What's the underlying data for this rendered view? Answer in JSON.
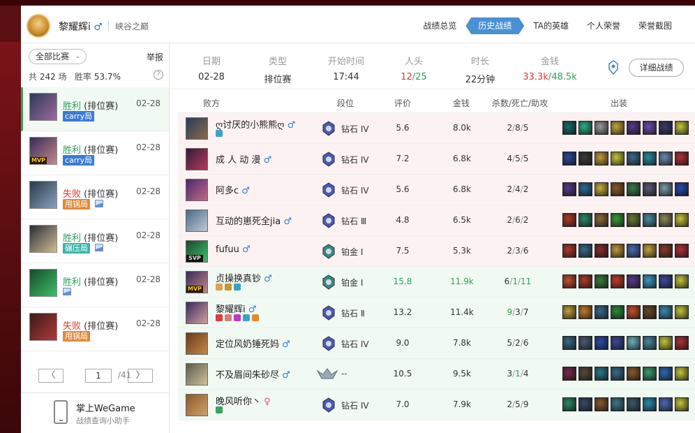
{
  "header": {
    "player_name": "黎耀辉i",
    "gender_symbol": "♂",
    "server": "峡谷之巅",
    "tabs": [
      {
        "label": "战绩总览",
        "active": false
      },
      {
        "label": "历史战绩",
        "active": true
      },
      {
        "label": "TA的英雄",
        "active": false
      },
      {
        "label": "个人荣誉",
        "active": false
      },
      {
        "label": "荣誉截图",
        "active": false
      }
    ]
  },
  "sidebar": {
    "filter_label": "全部比赛",
    "report_label": "举报",
    "stats_total_prefix": "共",
    "stats_total": "242",
    "stats_total_suffix": "场",
    "stats_winrate_label": "胜率",
    "stats_winrate": "53.7%",
    "help_symbol": "?",
    "matches": [
      {
        "result": "胜利",
        "type": "(排位赛)",
        "date": "02-28",
        "tag": "carry局",
        "mvp": "",
        "has_image": false,
        "win": true
      },
      {
        "result": "胜利",
        "type": "(排位赛)",
        "date": "02-28",
        "tag": "carry局",
        "mvp": "MVP",
        "has_image": false,
        "win": true
      },
      {
        "result": "失败",
        "type": "(排位赛)",
        "date": "02-28",
        "tag": "甩锅局",
        "mvp": "",
        "has_image": true,
        "win": false
      },
      {
        "result": "胜利",
        "type": "(排位赛)",
        "date": "02-28",
        "tag": "碾压局",
        "mvp": "",
        "has_image": true,
        "win": true
      },
      {
        "result": "胜利",
        "type": "(排位赛)",
        "date": "02-28",
        "tag": "",
        "mvp": "",
        "has_image": true,
        "win": true
      },
      {
        "result": "失败",
        "type": "(排位赛)",
        "date": "02-28",
        "tag": "甩锅局",
        "mvp": "",
        "has_image": false,
        "win": false
      }
    ],
    "pager": {
      "prev": "〈",
      "next": "〉",
      "current": "1",
      "total": "/41"
    },
    "wegame": {
      "title": "掌上WeGame",
      "subtitle": "战绩查询小助手"
    }
  },
  "summary": {
    "date_label": "日期",
    "date": "02-28",
    "type_label": "类型",
    "type": "排位赛",
    "start_label": "开始时间",
    "start": "17:44",
    "kills_label": "人头",
    "kills_red": "12",
    "kills_sep": "/",
    "kills_green": "25",
    "duration_label": "时长",
    "duration": "22分钟",
    "gold_label": "金钱",
    "gold_red": "33.3k",
    "gold_sep": "/",
    "gold_green": "48.5k",
    "detail_button": "详细战绩"
  },
  "table": {
    "headers": {
      "team": "败方",
      "rank": "段位",
      "score": "评价",
      "gold": "金钱",
      "kda": "杀数/死亡/助攻",
      "items": "出装"
    },
    "rows": [
      {
        "name": "ღ讨厌的小熊熊ღ",
        "gender": "♂",
        "rank": "钻石 IV",
        "score": "5.6",
        "gold": "8.0k",
        "k": "2",
        "d": "8",
        "a": "5",
        "team": "lose",
        "badge": "",
        "tags": [
          "#3aa3c4"
        ],
        "avatar": "#2a3a5a,#8a6a4a",
        "items": [
          "#1a6a6a",
          "#2ab08a",
          "#9a9aa0",
          "#c4a63a",
          "#5a3a8a",
          "#6a4ab0",
          "#3a3a6a",
          "#c4c43a"
        ]
      },
      {
        "name": "成 人 动 漫",
        "gender": "♂",
        "rank": "钻石 IV",
        "score": "7.2",
        "gold": "6.8k",
        "k": "4",
        "d": "5",
        "a": "5",
        "team": "lose",
        "badge": "",
        "tags": [],
        "avatar": "#3a1a3a,#b03a5a",
        "items": [
          "#2a4a9a",
          "#3a3a3a",
          "#c49a3a",
          "#c4c43a",
          "#3a6a8a",
          "#2a8aa0",
          "#6a8ab0",
          "#b0303a"
        ]
      },
      {
        "name": "阿多c",
        "gender": "♂",
        "rank": "钻石 IV",
        "score": "5.6",
        "gold": "6.8k",
        "k": "2",
        "d": "4",
        "a": "2",
        "team": "lose",
        "badge": "",
        "tags": [],
        "avatar": "#4a2a6a,#c06a8a",
        "items": [
          "#5a3a8a",
          "#2a6a9a",
          "#c4b03a",
          "#8a5a2a",
          "#3a7a4a",
          "#5a5a7a",
          "#7a9ab0",
          "#2a4ab0"
        ]
      },
      {
        "name": "互动的崽死全jia",
        "gender": "♂",
        "rank": "钻石 Ⅲ",
        "score": "4.8",
        "gold": "6.5k",
        "k": "2",
        "d": "6",
        "a": "2",
        "team": "lose",
        "badge": "",
        "tags": [],
        "avatar": "#4a6a8a,#c0c8d0",
        "items": [
          "#b03a2a",
          "#2a8a6a",
          "#8a6a3a",
          "#3a9a3a",
          "#6a7a3a",
          "#4a8aa0",
          "#8a8a5a",
          "#c4c43a"
        ]
      },
      {
        "name": "fufuu",
        "gender": "♂",
        "rank": "铂金 Ⅰ",
        "score": "7.5",
        "gold": "5.3k",
        "k": "2",
        "d": "3",
        "a": "6",
        "team": "lose",
        "badge": "SVP",
        "tags": [],
        "avatar": "#1a4a2a,#3ac06a",
        "items": [
          "#b03a2a",
          "#3a6a8a",
          "#8a2a2a",
          "#c49a3a",
          "#4a6ab0",
          "#c4a03a",
          "#8a3a2a",
          "#b0303a"
        ]
      },
      {
        "name": "贞操换真钞",
        "gender": "♂",
        "rank": "铂金 Ⅰ",
        "score": "15.8",
        "gold": "11.9k",
        "k": "6",
        "d": "1",
        "a": "11",
        "team": "win",
        "badge": "MVP",
        "tags": [
          "#e0a050",
          "#c09a30",
          "#3aa3c4"
        ],
        "avatar": "#3a2a5a,#c08a8a",
        "items": [
          "#c4502a",
          "#b03a2a",
          "#3a7a3a",
          "#c43a2a",
          "#5a3a8a",
          "#3a9ac4",
          "#3a4a9a",
          "#c4c43a"
        ]
      },
      {
        "name": "黎耀辉i",
        "gender": "♂",
        "rank": "钻石 Ⅱ",
        "score": "13.2",
        "gold": "11.4k",
        "k": "9",
        "d": "3",
        "a": "7",
        "team": "win",
        "badge": "",
        "tags": [
          "#e03a3a",
          "#d08080",
          "#c03ac0",
          "#3aa3c4",
          "#e08a2a"
        ],
        "avatar": "#3a2a5a,#d0a0a0",
        "items": [
          "#c4a03a",
          "#c47a2a",
          "#3a6a8a",
          "#2a8a3a",
          "#c4502a",
          "#6a4a2a",
          "#3a8ab0",
          "#c4c43a"
        ]
      },
      {
        "name": "定位风奶锤死妈",
        "gender": "♂",
        "rank": "钻石 IV",
        "score": "9.0",
        "gold": "7.8k",
        "k": "5",
        "d": "2",
        "a": "6",
        "team": "win",
        "badge": "",
        "tags": [],
        "avatar": "#6a3a1a,#c08a4a",
        "items": [
          "#3a6a8a",
          "#4a5a7a",
          "#2a4ab0",
          "#3a4a9a",
          "#6ab0c0",
          "#4a8aa0",
          "#c4c43a",
          "#b0303a"
        ]
      },
      {
        "name": "不及眉间朱砂尽",
        "gender": "♂",
        "rank": "--",
        "score": "10.5",
        "gold": "9.5k",
        "k": "3",
        "d": "1",
        "a": "4",
        "team": "win",
        "badge": "",
        "tags": [],
        "avatar": "#5a5a4a,#d0c0a0",
        "items": [
          "#7a2a4a",
          "#5a4a3a",
          "#2a7a8a",
          "#3a6a8a",
          "#8a5a2a",
          "#3a9a6a",
          "#2a6ab0",
          "#c4c43a"
        ]
      },
      {
        "name": "晚风听你丶",
        "gender": "♀",
        "rank": "钻石 IV",
        "score": "7.0",
        "gold": "7.9k",
        "k": "2",
        "d": "5",
        "a": "9",
        "team": "win",
        "badge": "",
        "tags": [
          "#3aa35e"
        ],
        "avatar": "#8a5a2a,#d0a06a",
        "items": [
          "#2a8a6a",
          "#3a4a6a",
          "#8a5a2a",
          "#3a7a8a",
          "#3a5a6a",
          "#2a8ab0",
          "#4a6ab0",
          "#c4c43a"
        ]
      }
    ]
  }
}
